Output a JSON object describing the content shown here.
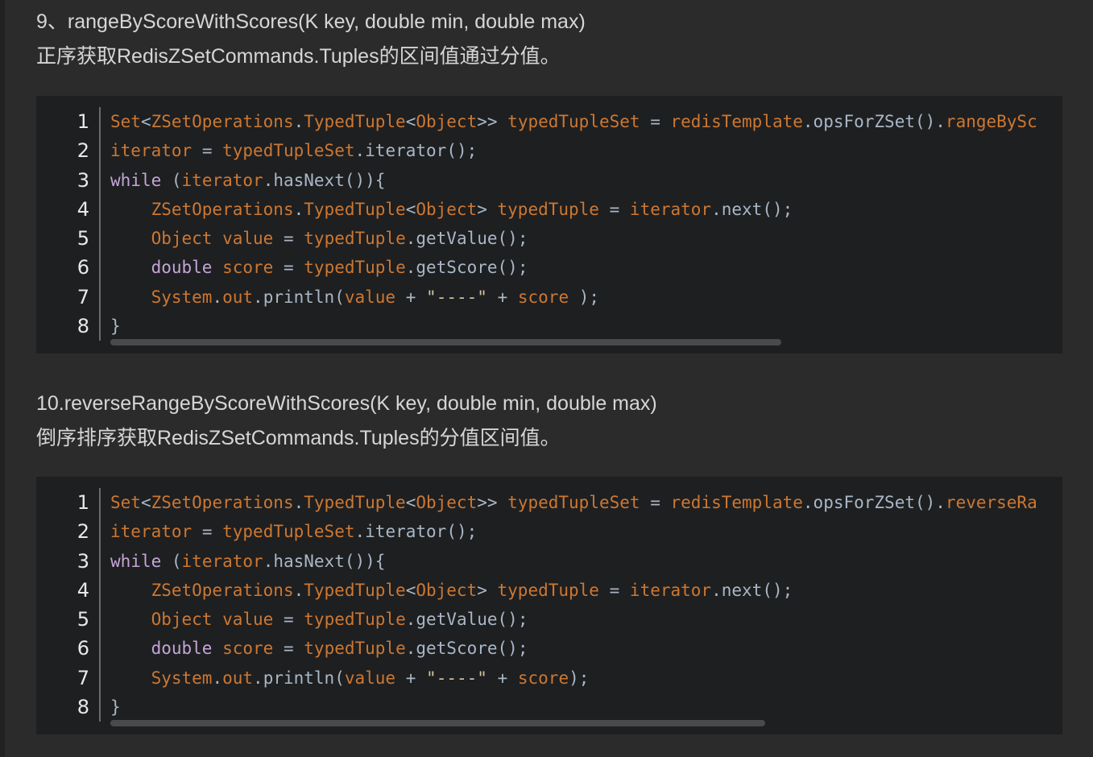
{
  "colors": {
    "background": "#2b2b2b",
    "code_background": "#1e1f21",
    "plain": "#a9b7c6",
    "identifier": "#cc7832",
    "keyword": "#c4a5d8",
    "string": "#cfc3a1",
    "brace": "#a9b7c6"
  },
  "section1": {
    "title": "9、rangeByScoreWithScores(K key, double min, double max)",
    "description": "正序获取RedisZSetCommands.Tuples的区间值通过分值。",
    "line_numbers": [
      "1",
      "2",
      "3",
      "4",
      "5",
      "6",
      "7",
      "8"
    ],
    "code_lines": [
      "Set<ZSetOperations.TypedTuple<Object>> typedTupleSet = redisTemplate.opsForZSet().rangeBySc",
      "iterator = typedTupleSet.iterator();",
      "while (iterator.hasNext()){",
      "    ZSetOperations.TypedTuple<Object> typedTuple = iterator.next();",
      "    Object value = typedTuple.getValue();",
      "    double score = typedTuple.getScore();",
      "    System.out.println(value + \"----\" + score );",
      "}"
    ]
  },
  "section2": {
    "title": "10.reverseRangeByScoreWithScores(K key, double min, double max)",
    "description": "倒序排序获取RedisZSetCommands.Tuples的分值区间值。",
    "line_numbers": [
      "1",
      "2",
      "3",
      "4",
      "5",
      "6",
      "7",
      "8"
    ],
    "code_lines": [
      "Set<ZSetOperations.TypedTuple<Object>> typedTupleSet = redisTemplate.opsForZSet().reverseRa",
      "iterator = typedTupleSet.iterator();",
      "while (iterator.hasNext()){",
      "    ZSetOperations.TypedTuple<Object> typedTuple = iterator.next();",
      "    Object value = typedTuple.getValue();",
      "    double score = typedTuple.getScore();",
      "    System.out.println(value + \"----\" + score);",
      "}"
    ]
  }
}
